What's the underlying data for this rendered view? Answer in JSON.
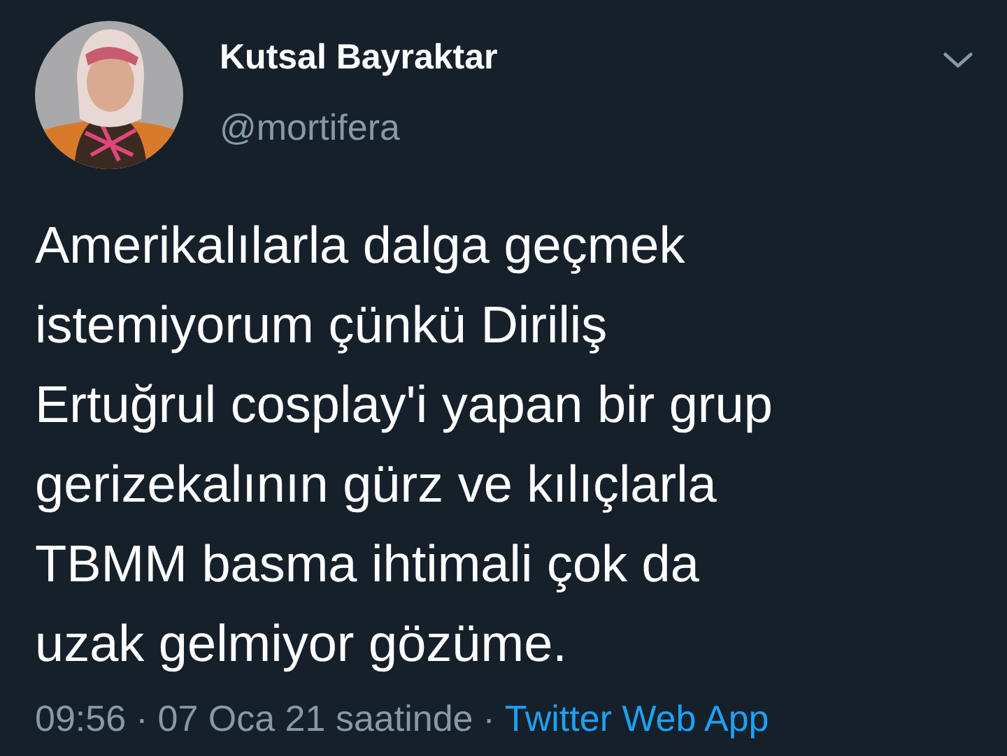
{
  "author": {
    "name": "Kutsal Bayraktar",
    "handle": "@mortifera"
  },
  "tweet": {
    "text_lines": [
      "Amerikalılarla dalga geçmek",
      "istemiyorum çünkü Diriliş",
      "Ertuğrul cosplay'i yapan bir grup",
      "gerizekalının gürz ve kılıçlarla",
      "TBMM basma ihtimali çok da",
      "uzak gelmiyor gözüme."
    ]
  },
  "meta": {
    "time": "09:56",
    "separator": "·",
    "date": "07 Oca 21 saatinde",
    "separator_2": "·",
    "source": "Twitter Web App"
  }
}
